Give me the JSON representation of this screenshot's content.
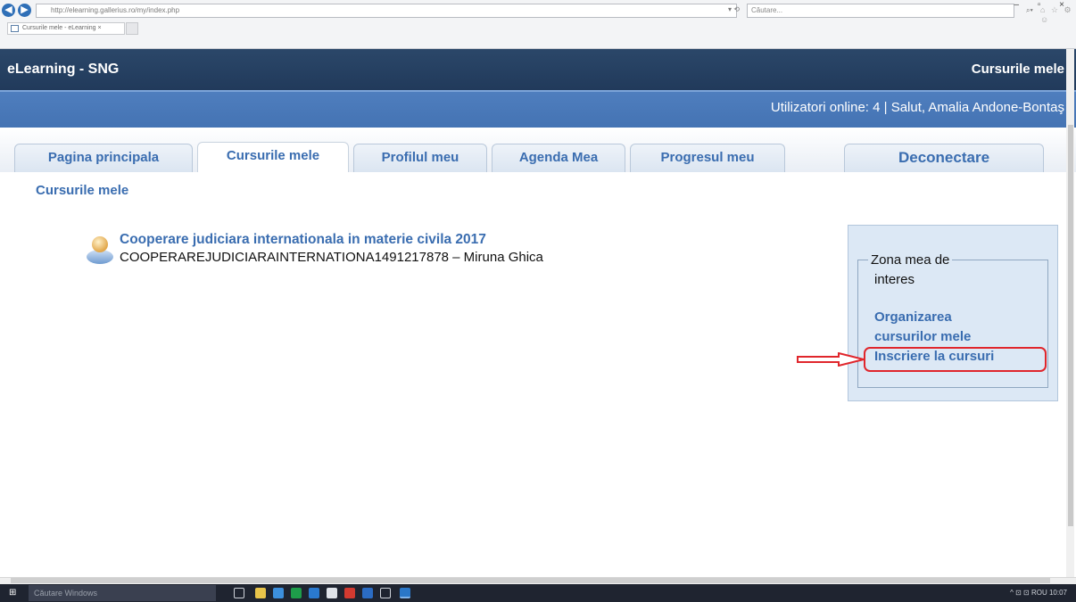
{
  "browser": {
    "address": "http://elearning.gallerius.ro/my/index.php",
    "address_tools": "▾ ⟲",
    "search_placeholder": "Căutare...",
    "search_icon_glyph": "⌕▾",
    "toolbar_glyphs": "⌂ ☆ ⚙ ☺",
    "tab_title": "Cursurile mele - eLearning",
    "tab_close": "×",
    "window_controls": "–  ▫  ×",
    "back_glyph": "◀",
    "forward_glyph": "▶"
  },
  "header": {
    "site_title": "eLearning - SNG",
    "section_title": "Cursurile mele"
  },
  "userbar": {
    "text": "Utilizatori online:  4  | Salut, Amalia Andone-Bontaş"
  },
  "tabs": [
    {
      "label": "Pagina principala"
    },
    {
      "label": "Cursurile mele"
    },
    {
      "label": "Profilul meu"
    },
    {
      "label": "Agenda Mea"
    },
    {
      "label": "Progresul meu"
    },
    {
      "label": "Deconectare"
    }
  ],
  "breadcrumb": "Cursurile mele",
  "course": {
    "title": "Cooperare judiciara internationala in materie civila 2017",
    "code_line": "COOPERAREJUDICIARAINTERNATIONA1491217878 – Miruna Ghica"
  },
  "side_panel": {
    "legend_line1": "Zona mea de",
    "legend_line2": "interes",
    "link_organize_line1": "Organizarea",
    "link_organize_line2": "cursurilor mele",
    "link_enroll": "Inscriere la cursuri"
  },
  "taskbar": {
    "search_placeholder": "Căutare Windows",
    "start_glyph": "⊞",
    "tray_text": "^ ⊡ ⊡ ROU  10:07"
  },
  "colors": {
    "header_bg": "#213a5b",
    "userbar_bg": "#4473b3",
    "link_blue": "#3a6db0",
    "highlight_red": "#e0262c"
  }
}
